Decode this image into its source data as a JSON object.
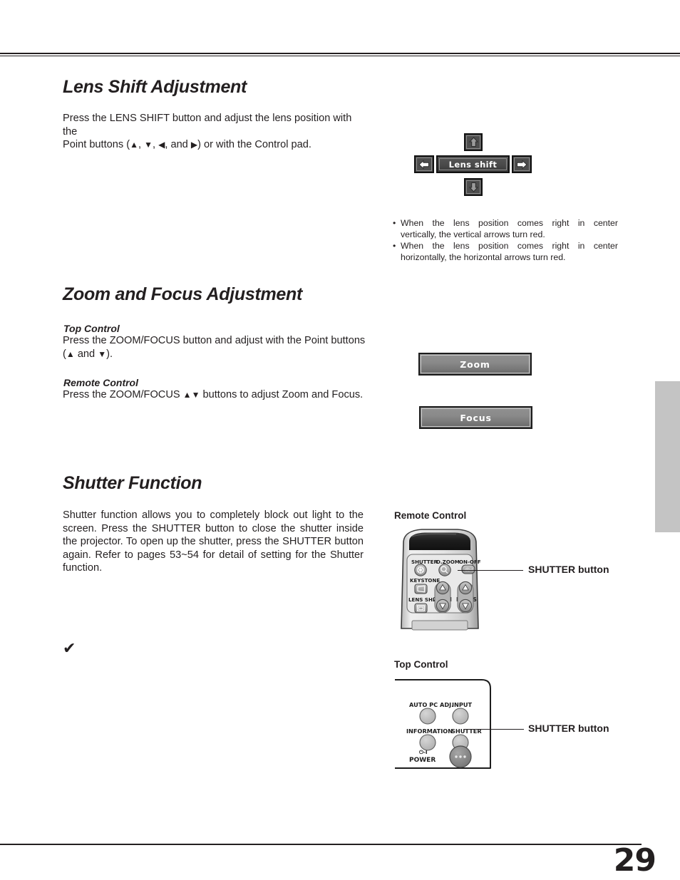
{
  "page": {
    "number": "29"
  },
  "sections": [
    {
      "id": "lens-shift",
      "heading": "Lens Shift Adjustment",
      "body": "Press the LENS SHIFT button and adjust the lens position with the Point buttons (▲, ▼, ◀, and ▶) or with the Control pad."
    },
    {
      "id": "zoom-focus",
      "heading": "Zoom and Focus Adjustment"
    },
    {
      "id": "shutter",
      "heading": "Shutter Function",
      "body": "Shutter function allows you to completely block out light to the screen. Press the SHUTTER button to close the shutter inside the projector. To open up the shutter, press the SHUTTER button again. Refer to pages 53~54 for detail of setting for the Shutter function."
    }
  ],
  "lens_shift": {
    "body_line1": "Press the LENS SHIFT button and adjust the lens position with the",
    "body_line2_a": "Point buttons (",
    "body_line2_tri_up": "▲",
    "body_line2_b": ", ",
    "body_line2_tri_down": "▼",
    "body_line2_c": ", ",
    "body_line2_tri_left": "◀",
    "body_line2_d": ", and ",
    "body_line2_tri_right": "▶",
    "body_line2_e": ") or with the Control pad.",
    "osd": {
      "label": "Lens shift",
      "arrow_up": "up-arrow",
      "arrow_down": "down-arrow",
      "arrow_left": "left-arrow",
      "arrow_right": "right-arrow",
      "vertical_arrow_color": "#9b9b9b",
      "horizontal_arrow_color": "#ffffff"
    },
    "notes": [
      {
        "line1": "When the lens position comes right in center",
        "line2": "vertically, the vertical arrows turn red."
      },
      {
        "line1": "When the lens position comes right in center",
        "line2": "horizontally, the horizontal arrows turn red."
      }
    ]
  },
  "zoom_focus": {
    "top_control_label": "Top Control",
    "top_control_line1": "Press the ZOOM/FOCUS button and adjust with the Point buttons",
    "top_control_line2_a": "(",
    "top_control_line2_tri_up": "▲",
    "top_control_line2_b": " and ",
    "top_control_line2_tri_down": "▼",
    "top_control_line2_c": ").",
    "remote_control_label": "Remote Control",
    "remote_control_line_a": "Press the ZOOM/FOCUS ",
    "remote_control_tri_up": "▲",
    "remote_control_tri_down": "▼",
    "remote_control_line_b": " buttons to adjust Zoom and Focus.",
    "osd_zoom_label": "Zoom",
    "osd_focus_label": "Focus"
  },
  "shutter": {
    "body": "Shutter function allows you to completely block out light to the screen. Press the SHUTTER button to close the shutter inside the projector. To open up the shutter, press the SHUTTER button again. Refer to pages 53~54 for detail of setting for the Shutter function.",
    "note_mark": "✔",
    "remote_figure_title": "Remote Control",
    "remote_callout": "SHUTTER button",
    "top_figure_title": "Top Control",
    "top_callout": "SHUTTER button",
    "remote_buttons": {
      "shutter": "SHUTTER",
      "d_zoom": "D.ZOOM",
      "on_off": "ON-OFF",
      "keystone": "KEYSTONE",
      "lens_shift": "LENS SHIFT",
      "zoom": "ZOOM",
      "focus": "FOCUS"
    },
    "top_control_buttons": {
      "auto_pc_adj": "AUTO PC ADJ.",
      "input": "INPUT",
      "information": "INFORMATION",
      "shutter": "SHUTTER",
      "power": "POWER",
      "power_symbol": "⏻-I"
    }
  }
}
